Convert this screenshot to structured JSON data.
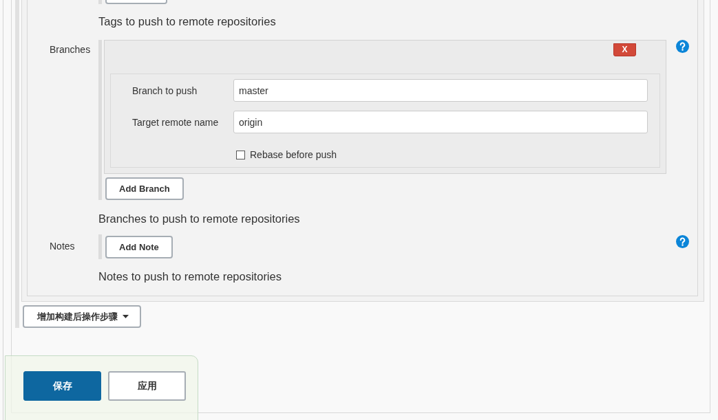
{
  "tags": {
    "description": "Tags to push to remote repositories"
  },
  "branches": {
    "label": "Branches",
    "entries": [
      {
        "delete_button": "X",
        "fields": [
          {
            "label": "Branch to push",
            "value": "master"
          },
          {
            "label": "Target remote name",
            "value": "origin"
          }
        ],
        "rebase": {
          "label": "Rebase before push",
          "checked": false
        }
      }
    ],
    "add_button": "Add Branch",
    "description": "Branches to push to remote repositories"
  },
  "notes": {
    "label": "Notes",
    "add_button": "Add Note",
    "description": "Notes to push to remote repositories"
  },
  "add_step_button": "增加构建后操作步骤",
  "actions": [
    {
      "label": "保存",
      "kind": "primary"
    },
    {
      "label": "应用",
      "kind": "secondary"
    }
  ]
}
